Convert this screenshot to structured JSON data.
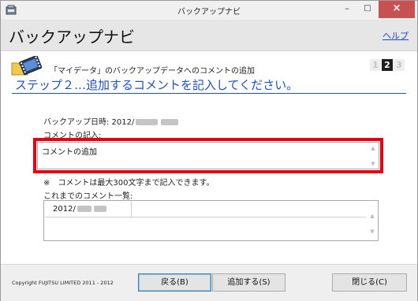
{
  "window": {
    "title": "バックアップナビ",
    "minimize": "–",
    "maximize": "□",
    "close": "×"
  },
  "header": {
    "title": "バックアップナビ",
    "help_link": "ヘルプ"
  },
  "step": {
    "caption": "「マイデータ」のバックアップデータへのコメントの追加",
    "numbers": [
      "1",
      "2",
      "3"
    ],
    "current": "2",
    "heading": "ステップ２…追加するコメントを記入してください。"
  },
  "form": {
    "backup_date_label": "バックアップ日時: 2012/",
    "comment_entry_label": "コメントの記入:",
    "comment_value": "コメントの追加",
    "note": "※　コメントは最大300文字まで記入できます。",
    "history_label": "これまでのコメント一覧:",
    "history_rows": [
      {
        "date": "2012/"
      }
    ]
  },
  "footer": {
    "copyright": "Copyright FUJITSU LIMITED 2011 - 2012",
    "back_button": "戻る(B)",
    "add_button": "追加する(S)",
    "close_button": "閉じる(C)"
  },
  "colors": {
    "accent_blue": "#1b4fd6",
    "highlight_red": "#e60012",
    "link_blue": "#1a47c8",
    "close_button": "#c75050"
  },
  "icons": {
    "app": "backup-app-icon",
    "step": "folder-film-icon"
  }
}
